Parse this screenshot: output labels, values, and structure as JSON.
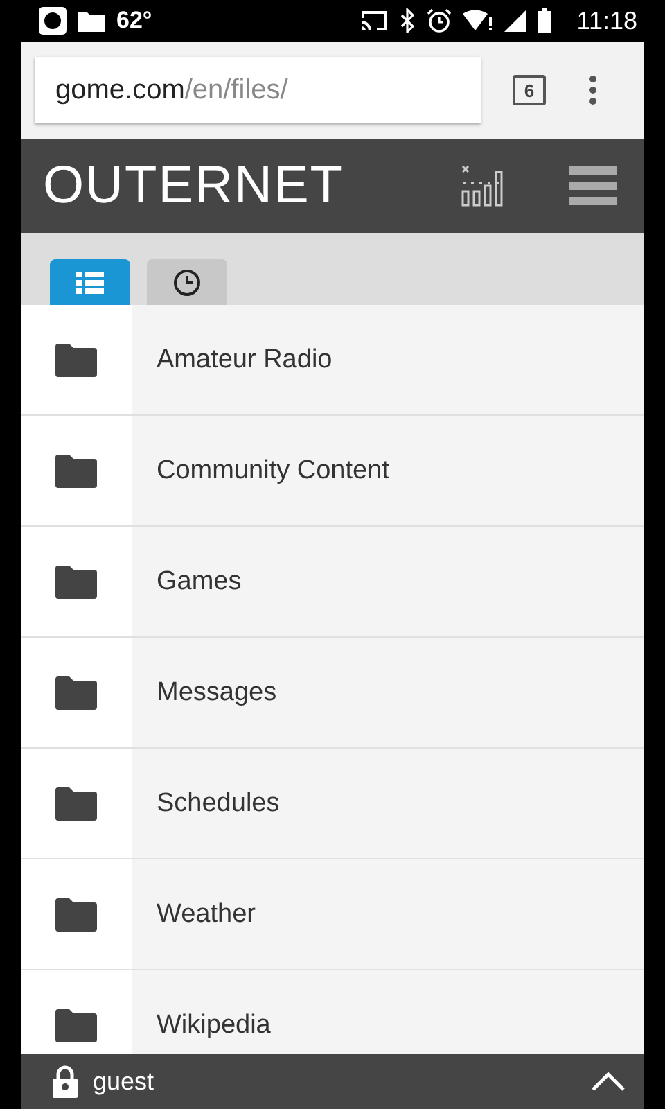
{
  "status_bar": {
    "temperature": "62°",
    "time": "11:18"
  },
  "browser": {
    "url": {
      "host": "gome.com",
      "path": "/en/files/"
    },
    "tab_count": "6"
  },
  "header": {
    "title": "OUTERNET"
  },
  "tabs": [
    {
      "kind": "list",
      "selected": true
    },
    {
      "kind": "clock",
      "selected": false
    }
  ],
  "folders": [
    {
      "name": "Amateur Radio"
    },
    {
      "name": "Community Content"
    },
    {
      "name": "Games"
    },
    {
      "name": "Messages"
    },
    {
      "name": "Schedules"
    },
    {
      "name": "Weather"
    },
    {
      "name": "Wikipedia"
    }
  ],
  "footer": {
    "user": "guest"
  }
}
